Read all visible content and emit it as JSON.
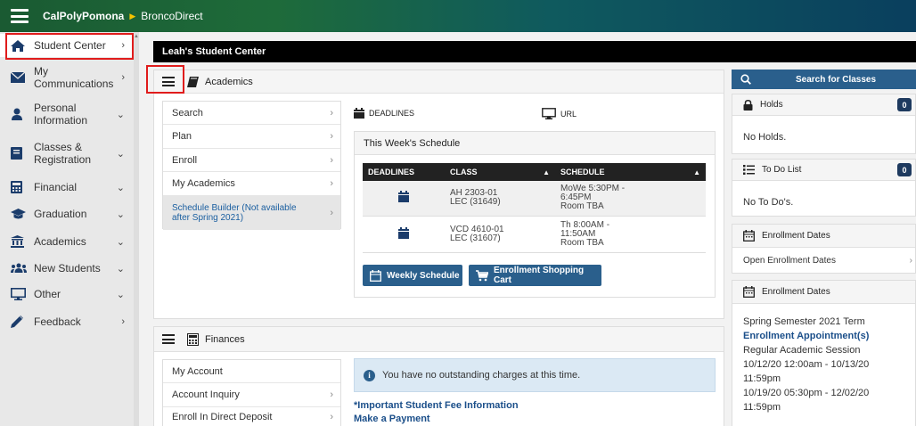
{
  "topbar": {
    "brand": "CalPolyPomona",
    "crumb": "BroncoDirect"
  },
  "sidebar": {
    "items": [
      {
        "label": "Student Center",
        "icon": "home-icon",
        "chevron": "›"
      },
      {
        "label": "My Communications",
        "icon": "envelope-icon",
        "chevron": "›"
      },
      {
        "label": "Personal Information",
        "icon": "person-icon",
        "chevron": "⌄"
      },
      {
        "label": "Classes & Registration",
        "icon": "notebook-icon",
        "chevron": "⌄"
      },
      {
        "label": "Financial",
        "icon": "calculator-icon",
        "chevron": "⌄"
      },
      {
        "label": "Graduation",
        "icon": "graduation-cap-icon",
        "chevron": "⌄"
      },
      {
        "label": "Academics",
        "icon": "institution-icon",
        "chevron": "⌄"
      },
      {
        "label": "New Students",
        "icon": "users-icon",
        "chevron": "⌄"
      },
      {
        "label": "Other",
        "icon": "monitor-icon",
        "chevron": "⌄"
      },
      {
        "label": "Feedback",
        "icon": "pencil-icon",
        "chevron": "›"
      }
    ]
  },
  "header": {
    "title": "Leah's Student Center"
  },
  "academics": {
    "title": "Academics",
    "menu": [
      {
        "label": "Search"
      },
      {
        "label": "Plan"
      },
      {
        "label": "Enroll"
      },
      {
        "label": "My Academics"
      },
      {
        "label": "Schedule Builder (Not available after Spring 2021)"
      }
    ],
    "deadlines_label": "DEADLINES",
    "url_label": "URL",
    "schedule_title": "This Week's Schedule",
    "table": {
      "headers": [
        "DEADLINES",
        "CLASS",
        "SCHEDULE"
      ],
      "rows": [
        {
          "class_line1": "AH 2303-01",
          "class_line2": "LEC (31649)",
          "sched_line1": "MoWe 5:30PM -",
          "sched_line2": "6:45PM",
          "sched_line3": "Room  TBA"
        },
        {
          "class_line1": "VCD 4610-01",
          "class_line2": "LEC (31607)",
          "sched_line1": "Th 8:00AM -",
          "sched_line2": "11:50AM",
          "sched_line3": "Room  TBA"
        }
      ]
    },
    "weekly_button": "Weekly Schedule",
    "cart_button": "Enrollment Shopping Cart"
  },
  "finances": {
    "title": "Finances",
    "menu": [
      {
        "label": "My Account"
      },
      {
        "label": "Account Inquiry"
      },
      {
        "label": "Enroll In Direct Deposit"
      }
    ],
    "info": "You have no outstanding charges at this time.",
    "fee_link": "*Important Student Fee Information",
    "payment_link": "Make a Payment"
  },
  "right": {
    "search_label": "Search for Classes",
    "holds": {
      "title": "Holds",
      "count": "0",
      "body": "No Holds."
    },
    "todo": {
      "title": "To Do List",
      "count": "0",
      "body": "No To Do's."
    },
    "enroll_dates_1": {
      "title": "Enrollment Dates",
      "link": "Open Enrollment Dates"
    },
    "enroll_dates_2": {
      "title": "Enrollment Dates",
      "term": "Spring Semester 2021 Term",
      "appt": "Enrollment Appointment(s)",
      "session": "Regular Academic Session",
      "range1a": "10/12/20 12:00am - 10/13/20",
      "range1b": "11:59pm",
      "range2a": "10/19/20 05:30pm - 12/02/20",
      "range2b": "11:59pm"
    }
  }
}
